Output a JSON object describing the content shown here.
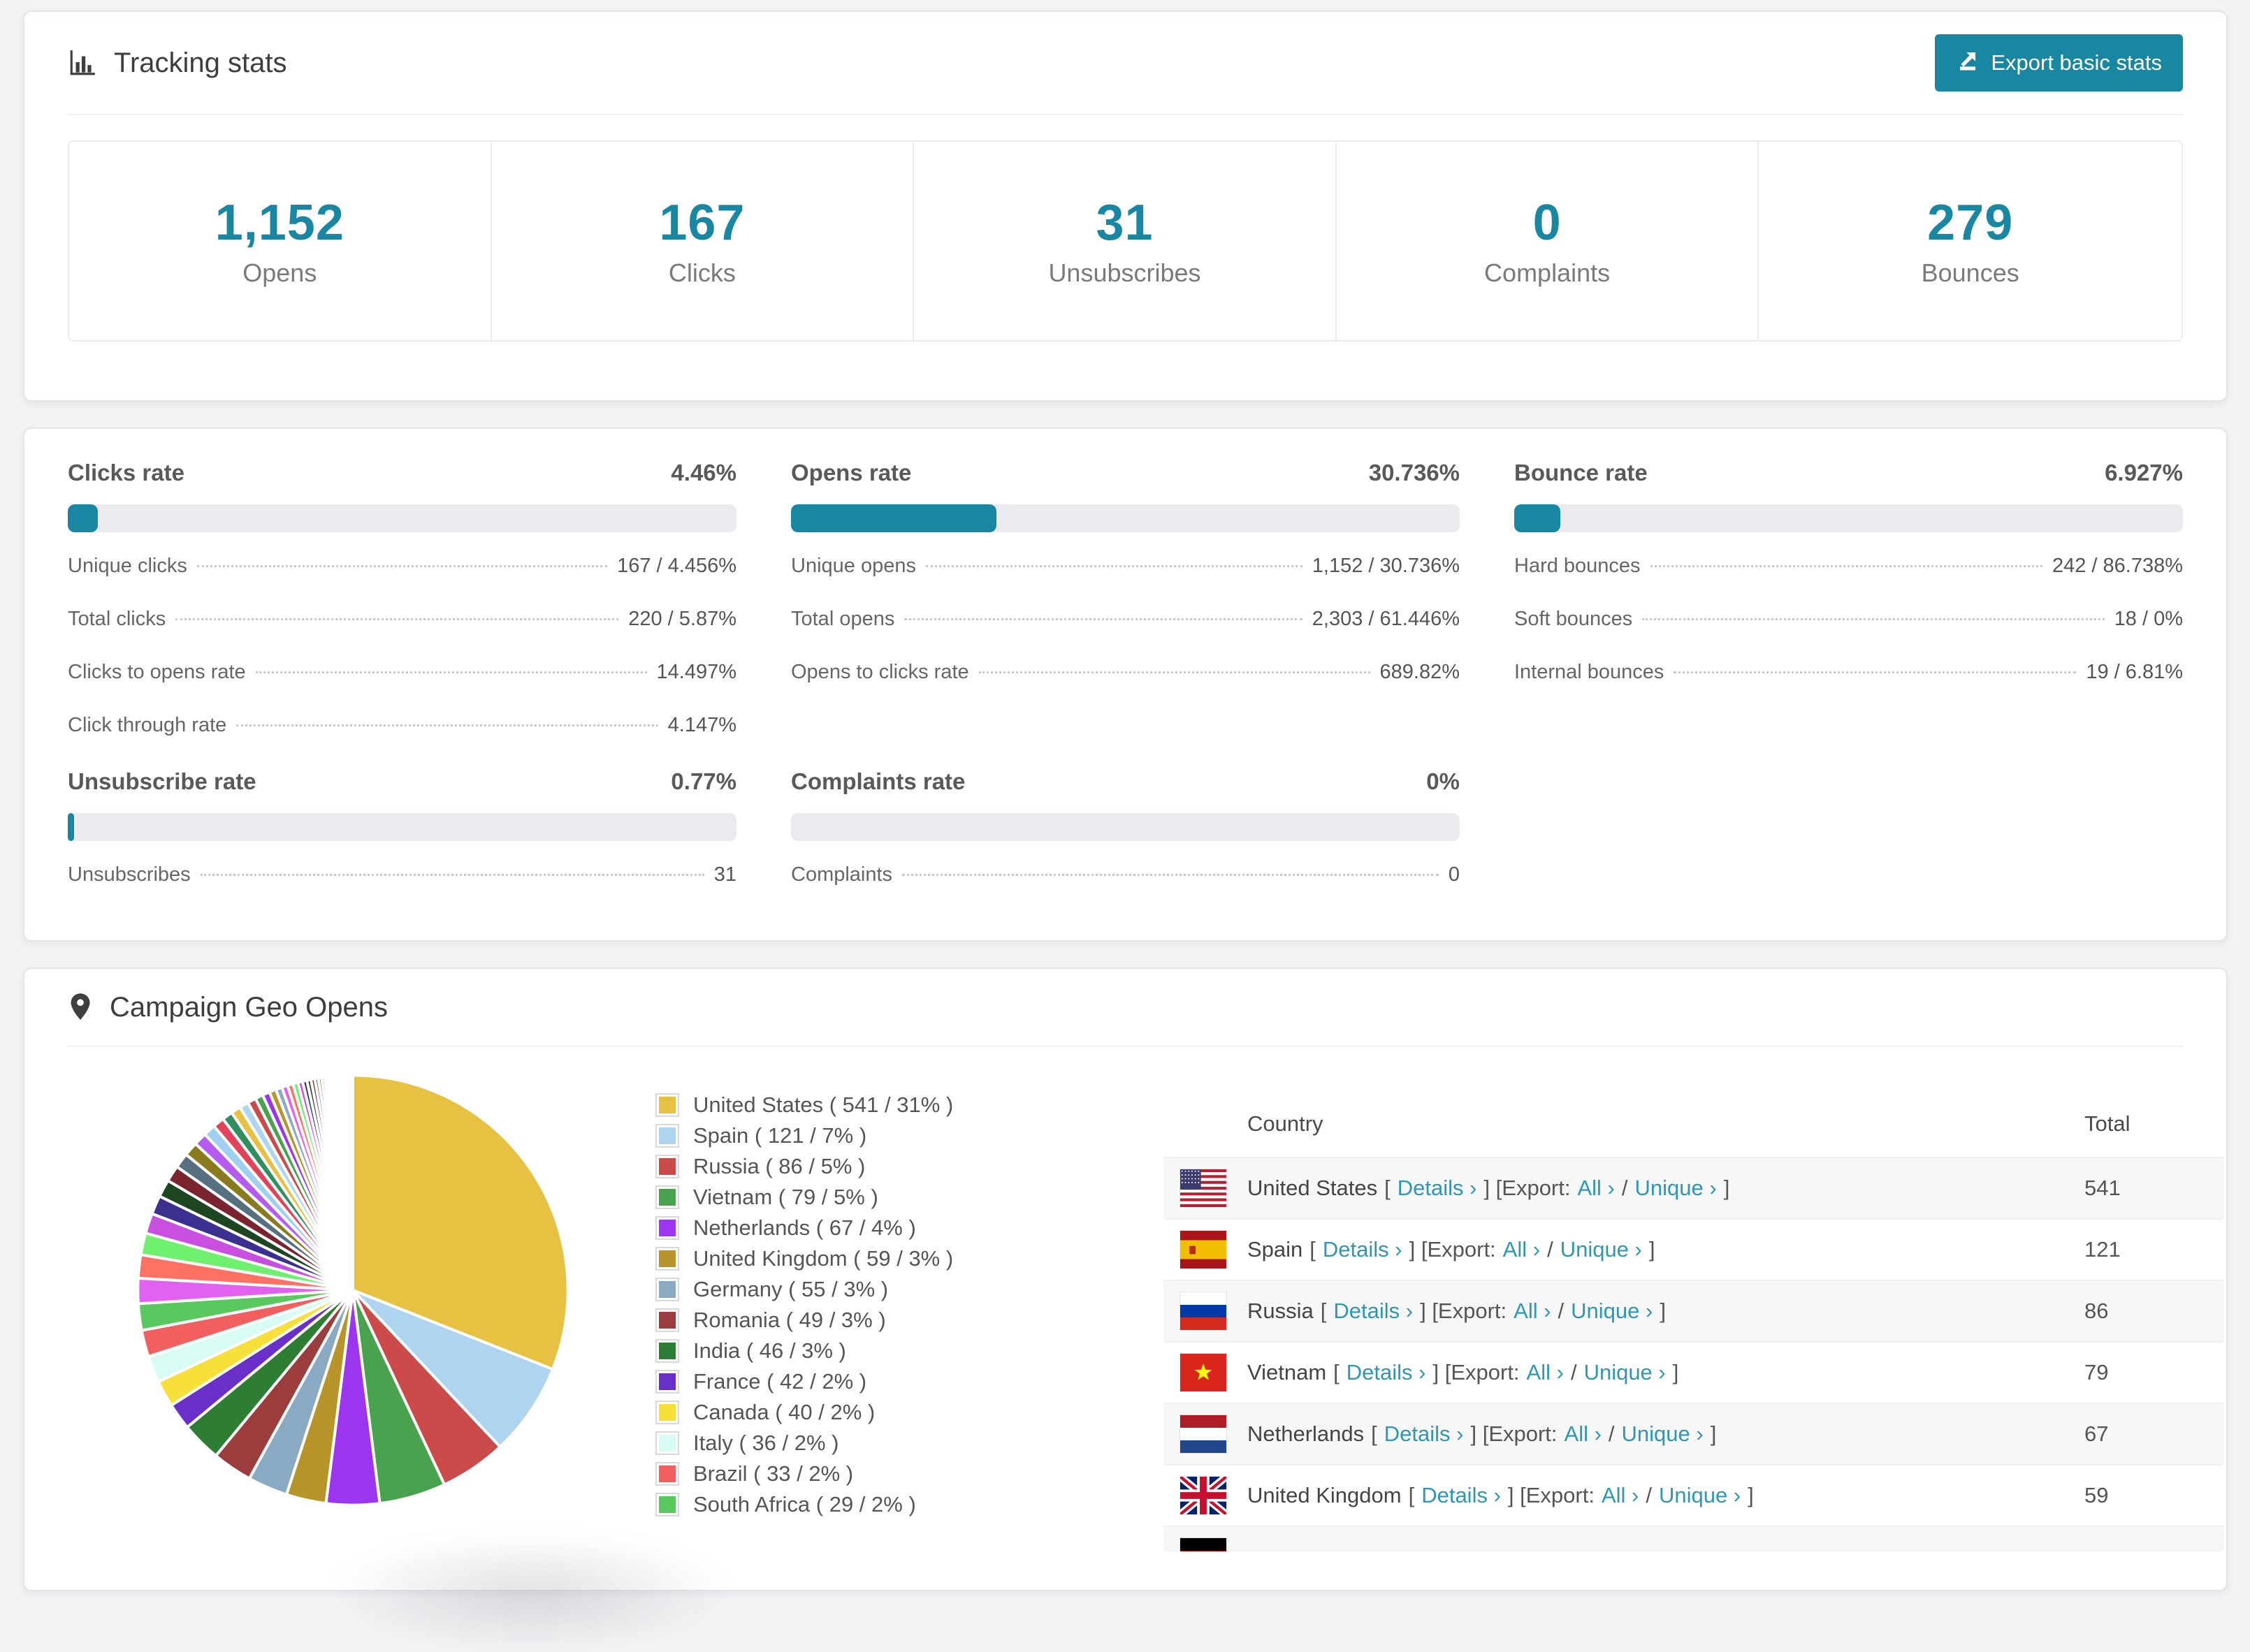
{
  "accent": "#1a87a2",
  "page_bg": "#f2f3f5",
  "tracking": {
    "title": "Tracking stats",
    "export_label": "Export basic stats",
    "stats": [
      {
        "value": "1,152",
        "label": "Opens"
      },
      {
        "value": "167",
        "label": "Clicks"
      },
      {
        "value": "31",
        "label": "Unsubscribes"
      },
      {
        "value": "0",
        "label": "Complaints"
      },
      {
        "value": "279",
        "label": "Bounces"
      }
    ]
  },
  "rates": [
    {
      "title": "Clicks rate",
      "value": "4.46%",
      "percent": 4.46,
      "rows": [
        {
          "label": "Unique clicks",
          "value": "167 / 4.456%"
        },
        {
          "label": "Total clicks",
          "value": "220 / 5.87%"
        },
        {
          "label": "Clicks to opens rate",
          "value": "14.497%"
        },
        {
          "label": "Click through rate",
          "value": "4.147%"
        }
      ]
    },
    {
      "title": "Opens rate",
      "value": "30.736%",
      "percent": 30.736,
      "rows": [
        {
          "label": "Unique opens",
          "value": "1,152 / 30.736%"
        },
        {
          "label": "Total opens",
          "value": "2,303 / 61.446%"
        },
        {
          "label": "Opens to clicks rate",
          "value": "689.82%"
        }
      ]
    },
    {
      "title": "Bounce rate",
      "value": "6.927%",
      "percent": 6.927,
      "rows": [
        {
          "label": "Hard bounces",
          "value": "242 / 86.738%"
        },
        {
          "label": "Soft bounces",
          "value": "18 / 0%"
        },
        {
          "label": "Internal bounces",
          "value": "19 / 6.81%"
        }
      ]
    },
    {
      "title": "Unsubscribe rate",
      "value": "0.77%",
      "percent": 0.77,
      "rows": [
        {
          "label": "Unsubscribes",
          "value": "31"
        }
      ]
    },
    {
      "title": "Complaints rate",
      "value": "0%",
      "percent": 0,
      "rows": [
        {
          "label": "Complaints",
          "value": "0"
        }
      ]
    }
  ],
  "geo": {
    "title": "Campaign Geo Opens",
    "legend": [
      {
        "label": "United States ( 541 / 31% )",
        "color": "#e7c242"
      },
      {
        "label": "Spain ( 121 / 7% )",
        "color": "#aed4ef"
      },
      {
        "label": "Russia ( 86 / 5% )",
        "color": "#cb4b4b"
      },
      {
        "label": "Vietnam ( 79 / 5% )",
        "color": "#49a24d"
      },
      {
        "label": "Netherlands ( 67 / 4% )",
        "color": "#9b36ee"
      },
      {
        "label": "United Kingdom ( 59 / 3% )",
        "color": "#b8952a"
      },
      {
        "label": "Germany ( 55 / 3% )",
        "color": "#8aa9c2"
      },
      {
        "label": "Romania ( 49 / 3% )",
        "color": "#9c3d3d"
      },
      {
        "label": "India ( 46 / 3% )",
        "color": "#2e7d34"
      },
      {
        "label": "France ( 42 / 2% )",
        "color": "#6930c9"
      },
      {
        "label": "Canada ( 40 / 2% )",
        "color": "#f8e03b"
      },
      {
        "label": "Italy ( 36 / 2% )",
        "color": "#d8fbf4"
      },
      {
        "label": "Brazil ( 33 / 2% )",
        "color": "#f25f5f"
      },
      {
        "label": "South Africa ( 29 / 2% )",
        "color": "#59c95f"
      }
    ],
    "table": {
      "headers": [
        "Country",
        "Total"
      ],
      "links": {
        "open": "[",
        "close": "]",
        "details": "Details ›",
        "export": "[Export:",
        "all": "All ›",
        "sep": "/",
        "unique": "Unique ›"
      },
      "rows": [
        {
          "country": "United States",
          "flag": "us",
          "total": "541"
        },
        {
          "country": "Spain",
          "flag": "es",
          "total": "121"
        },
        {
          "country": "Russia",
          "flag": "ru",
          "total": "86"
        },
        {
          "country": "Vietnam",
          "flag": "vn",
          "total": "79"
        },
        {
          "country": "Netherlands",
          "flag": "nl",
          "total": "67"
        },
        {
          "country": "United Kingdom",
          "flag": "gb",
          "total": "59"
        }
      ],
      "partial_row": {
        "flag": "de"
      }
    }
  },
  "chart_data": {
    "type": "pie",
    "title": "Campaign Geo Opens",
    "unit": "opens",
    "legend_position": "right",
    "start_angle_deg": -90,
    "direction": "clockwise",
    "slices": [
      {
        "label": "United States",
        "value": 541,
        "pct": 31,
        "color": "#e7c242"
      },
      {
        "label": "Spain",
        "value": 121,
        "pct": 7,
        "color": "#aed4ef"
      },
      {
        "label": "Russia",
        "value": 86,
        "pct": 5,
        "color": "#cb4b4b"
      },
      {
        "label": "Vietnam",
        "value": 79,
        "pct": 5,
        "color": "#49a24d"
      },
      {
        "label": "Netherlands",
        "value": 67,
        "pct": 4,
        "color": "#9b36ee"
      },
      {
        "label": "United Kingdom",
        "value": 59,
        "pct": 3,
        "color": "#b8952a"
      },
      {
        "label": "Germany",
        "value": 55,
        "pct": 3,
        "color": "#8aa9c2"
      },
      {
        "label": "Romania",
        "value": 49,
        "pct": 3,
        "color": "#9c3d3d"
      },
      {
        "label": "India",
        "value": 46,
        "pct": 3,
        "color": "#2e7d34"
      },
      {
        "label": "France",
        "value": 42,
        "pct": 2,
        "color": "#6930c9"
      },
      {
        "label": "Canada",
        "value": 40,
        "pct": 2,
        "color": "#f8e03b"
      },
      {
        "label": "Italy",
        "value": 36,
        "pct": 2,
        "color": "#d8fbf4"
      },
      {
        "label": "Brazil",
        "value": 33,
        "pct": 2,
        "color": "#f25f5f"
      },
      {
        "label": "South Africa",
        "value": 29,
        "pct": 2,
        "color": "#59c95f"
      }
    ],
    "others_pct": 26,
    "tail_slice_count": 46,
    "tail_decay": 0.93,
    "palette_cycle": [
      "#e261f0",
      "#ff7163",
      "#6ef06e",
      "#c84fe0",
      "#3b2f8f",
      "#1e4620",
      "#7a2430",
      "#56707f",
      "#8a7a1e",
      "#b55bf0",
      "#9fd0f0",
      "#e0435a",
      "#2f8f5f",
      "#e7c242",
      "#aed4ef",
      "#cb4b4b",
      "#49a24d",
      "#9b36ee",
      "#b8952a",
      "#8aa9c2"
    ]
  }
}
